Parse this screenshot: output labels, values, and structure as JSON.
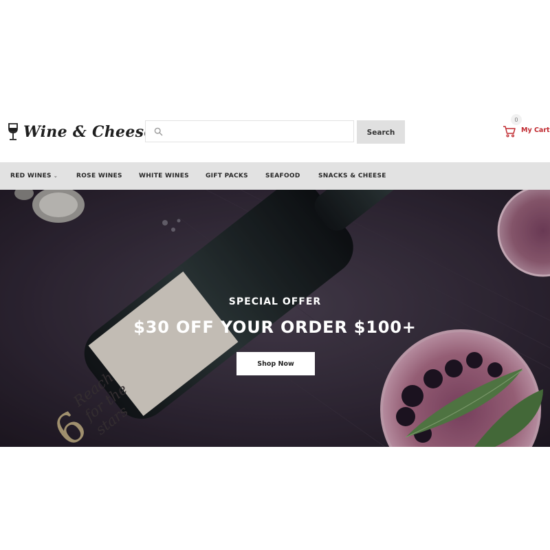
{
  "brand": {
    "name": "Wine & Cheese",
    "icon": "wine-glass-icon"
  },
  "search": {
    "placeholder": "",
    "value": "",
    "button_label": "Search",
    "icon": "search-icon"
  },
  "cart": {
    "count": "0",
    "label": "My Cart",
    "icon": "shopping-cart-icon"
  },
  "nav": {
    "items": [
      {
        "label": "RED WINES",
        "has_dropdown": true
      },
      {
        "label": "ROSE WINES"
      },
      {
        "label": "WHITE WINES"
      },
      {
        "label": "GIFT PACKS"
      },
      {
        "label": "SEAFOOD"
      },
      {
        "label": "SNACKS & CHEESE"
      }
    ]
  },
  "hero": {
    "subtitle": "SPECIAL OFFER",
    "title": "$30 OFF YOUR ORDER $100+",
    "button_label": "Shop Now",
    "bottle_label": {
      "number": "6",
      "lines": [
        "Reach",
        "for the",
        "stars"
      ]
    }
  },
  "colors": {
    "accent": "#c0292f",
    "nav_background": "#e2e2e2",
    "search_button": "#e0e0e0",
    "hero_dark": "#2a2330"
  }
}
